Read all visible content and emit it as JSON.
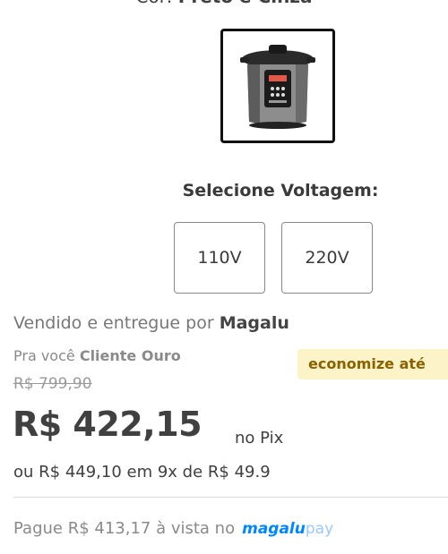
{
  "variant": {
    "color_label": "Cor:",
    "color_value": "Preto e Cinza",
    "image_name": "pressure-cooker-image"
  },
  "voltage": {
    "title": "Selecione Voltagem:",
    "options": [
      "110V",
      "220V"
    ]
  },
  "seller": {
    "prefix": "Vendido e entregue por",
    "name": "Magalu"
  },
  "client": {
    "prefix": "Pra você",
    "tier": "Cliente Ouro"
  },
  "promo": {
    "text": "economize até"
  },
  "pricing": {
    "old_price": "R$ 799,90",
    "price": "R$ 422,15",
    "price_method": "no Pix",
    "installments": "ou R$ 449,10 em 9x de R$ 49.9",
    "cash_text": "Pague R$ 413,17 à vista no",
    "brand_a": "magalu",
    "brand_b": "pay"
  },
  "colors": {
    "brand_blue": "#0086ff",
    "promo_bg": "#fdf3c8",
    "promo_text": "#8a6200"
  }
}
